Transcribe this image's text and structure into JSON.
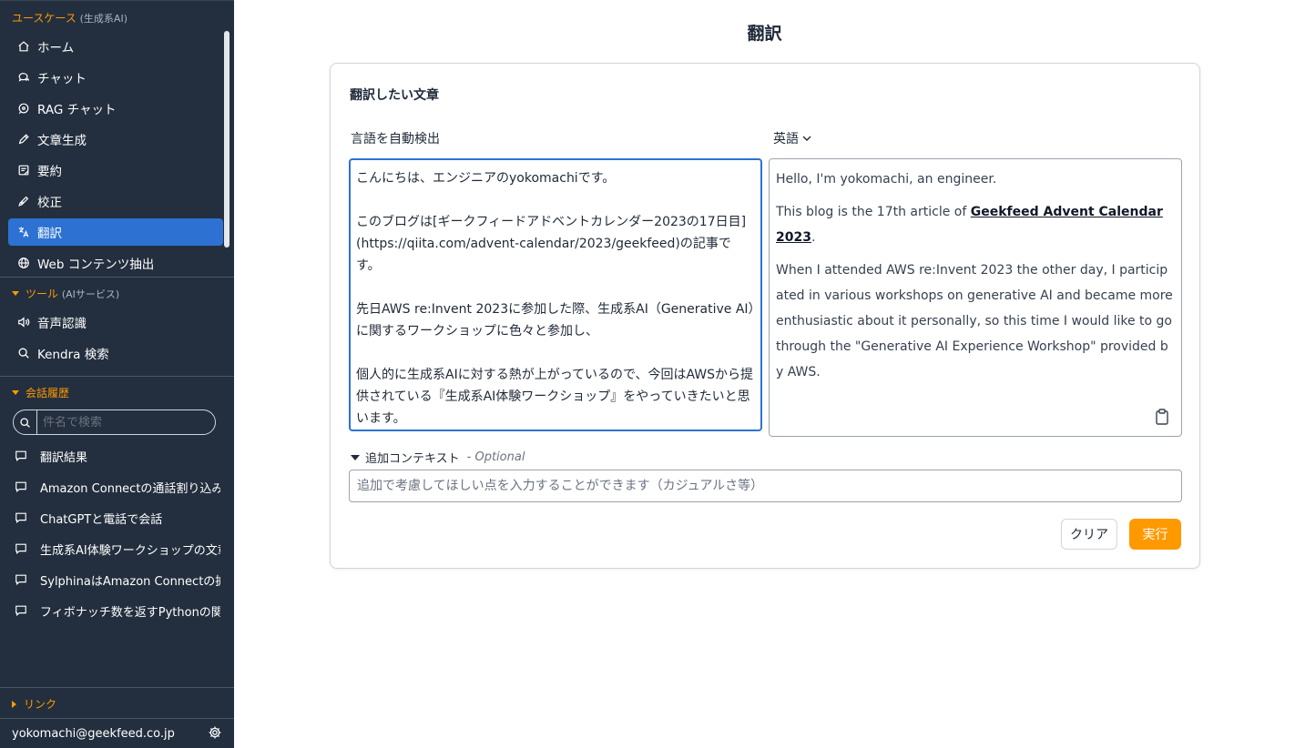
{
  "sidebar": {
    "usecase_title": "ユースケース",
    "usecase_sub": "(生成系AI)",
    "items": [
      {
        "label": "ホーム",
        "icon": "home-icon"
      },
      {
        "label": "チャット",
        "icon": "chat-icon"
      },
      {
        "label": "RAG チャット",
        "icon": "rag-chat-icon"
      },
      {
        "label": "文章生成",
        "icon": "pencil-icon"
      },
      {
        "label": "要約",
        "icon": "summary-icon"
      },
      {
        "label": "校正",
        "icon": "proofread-icon"
      },
      {
        "label": "翻訳",
        "icon": "translate-icon",
        "active": true
      },
      {
        "label": "Web コンテンツ抽出",
        "icon": "globe-icon"
      }
    ],
    "tools_title": "ツール",
    "tools_sub": "(AIサービス)",
    "tools": [
      {
        "label": "音声認識",
        "icon": "speaker-icon"
      },
      {
        "label": "Kendra 検索",
        "icon": "search-icon"
      }
    ],
    "history_title": "会話履歴",
    "history_search_placeholder": "件名で検索",
    "history": [
      "翻訳結果",
      "Amazon Connectの通話割り込み",
      "ChatGPTと電話で会話",
      "生成系AI体験ワークショップの文章",
      "SylphinaはAmazon Connectの拡",
      "フィボナッチ数を返すPythonの関数"
    ],
    "links_title": "リンク",
    "user_email": "yokomachi@geekfeed.co.jp"
  },
  "main": {
    "title": "翻訳",
    "card_title": "翻訳したい文章",
    "source_lang": "言語を自動検出",
    "target_lang": "英語",
    "source_text": "こんにちは、エンジニアのyokomachiです。\n\nこのブログは[ギークフィードアドベントカレンダー2023の17日目](https://qiita.com/advent-calendar/2023/geekfeed)の記事です。\n\n先日AWS re:Invent 2023に参加した際、生成系AI（Generative AI）に関するワークショップに色々と参加し、\n\n個人的に生成系AIに対する熱が上がっているので、今回はAWSから提供されている『生成系AI体験ワークショップ』をやっていきたいと思います。",
    "result": {
      "p1": "Hello, I'm yokomachi, an engineer.",
      "p2_prefix": "This blog is the 17th article of ",
      "p2_link": "Geekfeed Advent Calendar 2023",
      "p2_suffix": ".",
      "p3": "When I attended AWS re:Invent 2023 the other day, I participated in various workshops on generative AI and became more enthusiastic about it personally, so this time I would like to go through the \"Generative AI Experience Workshop\" provided by AWS."
    },
    "context_label": "追加コンテキスト",
    "context_dash": "-",
    "context_optional": "Optional",
    "context_placeholder": "追加で考慮してほしい点を入力することができます（カジュアルさ等）",
    "clear_label": "クリア",
    "run_label": "実行"
  },
  "colors": {
    "sidebar_bg": "#232f3e",
    "accent_orange": "#ff9900",
    "active_blue": "#2d72d2"
  }
}
